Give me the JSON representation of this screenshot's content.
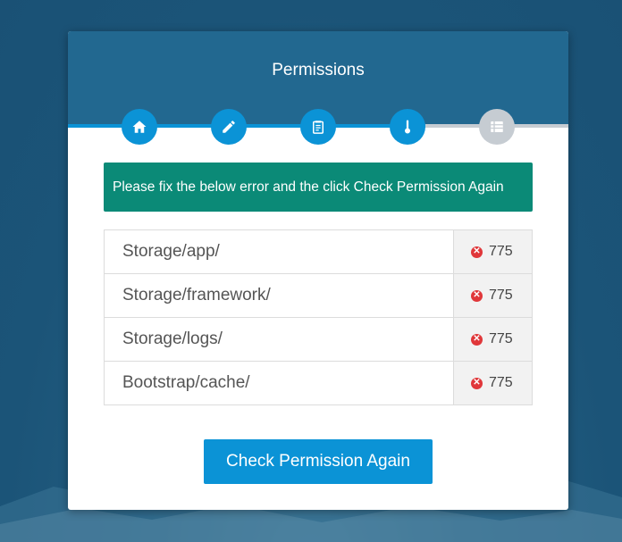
{
  "colors": {
    "header_bg": "#226890",
    "accent_blue": "#0b93d6",
    "alert_green": "#0b8a77",
    "error_red": "#e0373a",
    "inactive_step": "#c6ccd2"
  },
  "card": {
    "title": "Permissions"
  },
  "steps": [
    {
      "icon": "home-icon",
      "state": "done"
    },
    {
      "icon": "pencil-icon",
      "state": "done"
    },
    {
      "icon": "clipboard-icon",
      "state": "done"
    },
    {
      "icon": "thermometer-icon",
      "state": "done"
    },
    {
      "icon": "list-icon",
      "state": "todo"
    }
  ],
  "alert": {
    "message": "Please fix the below error and the click Check Permission Again"
  },
  "permissions": [
    {
      "path": "Storage/app/",
      "status_icon": "error-icon",
      "value": "775"
    },
    {
      "path": "Storage/framework/",
      "status_icon": "error-icon",
      "value": "775"
    },
    {
      "path": "Storage/logs/",
      "status_icon": "error-icon",
      "value": "775"
    },
    {
      "path": "Bootstrap/cache/",
      "status_icon": "error-icon",
      "value": "775"
    }
  ],
  "actions": {
    "check_label": "Check Permission Again"
  }
}
